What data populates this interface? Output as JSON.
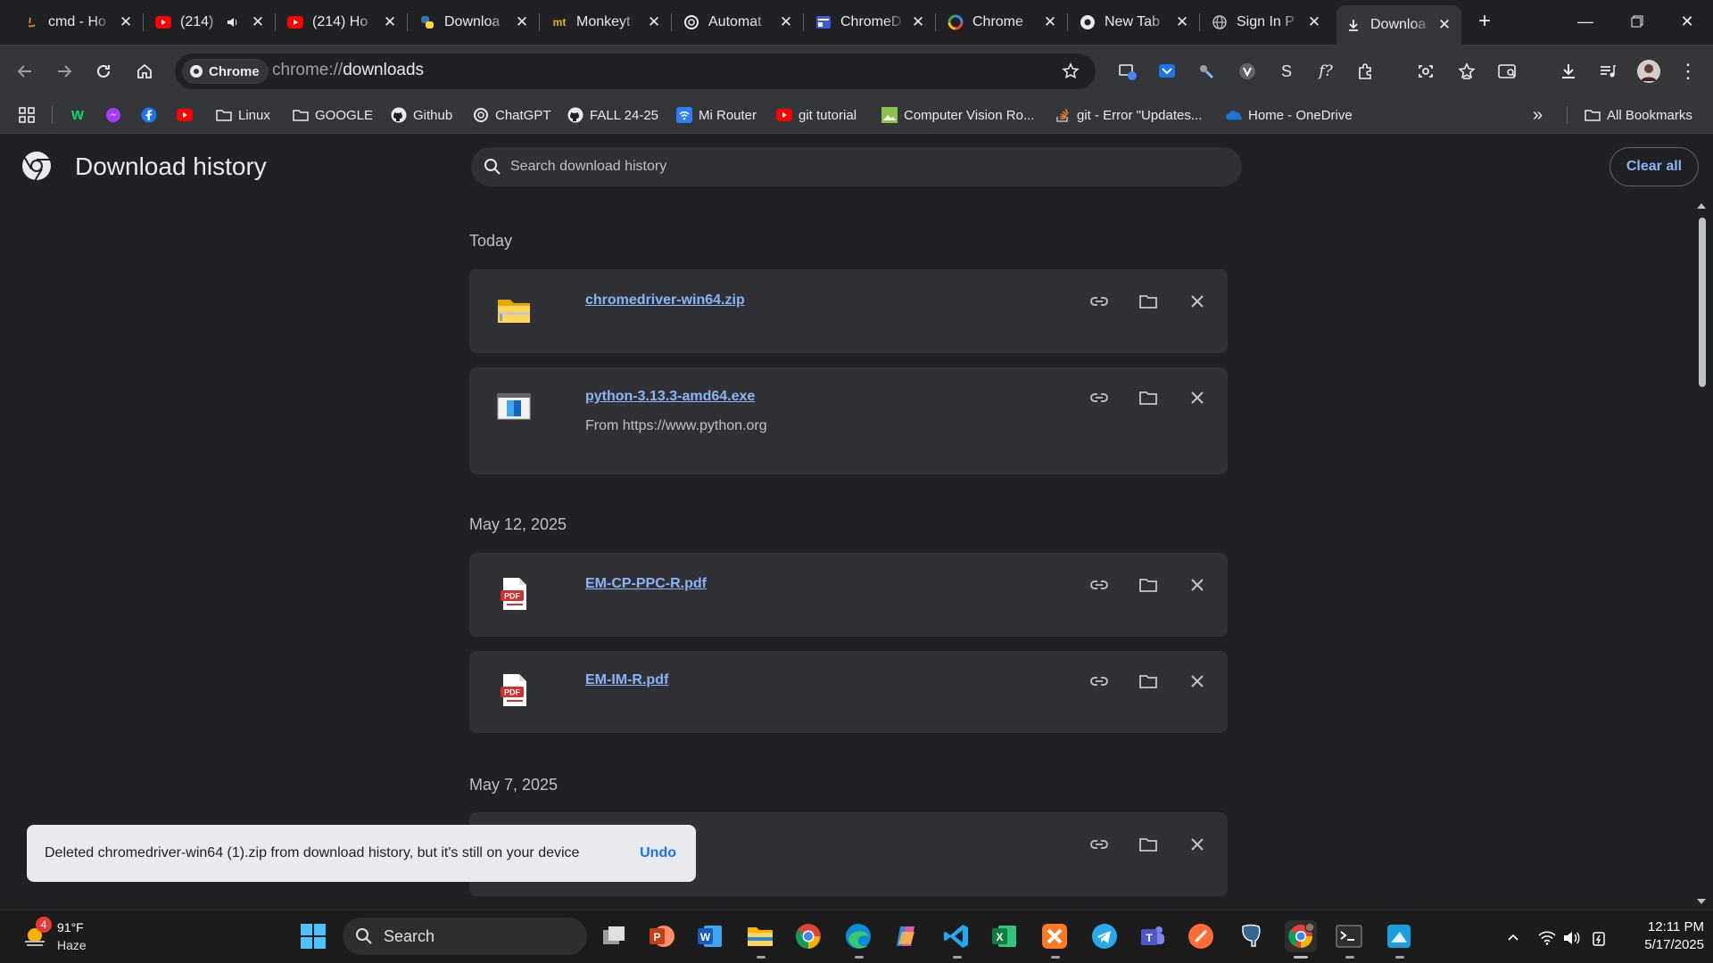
{
  "tabs": [
    {
      "title": "cmd - Ho",
      "icon": "java-icon"
    },
    {
      "title": "(214)",
      "icon": "youtube-icon"
    },
    {
      "title": "(214) Ho",
      "icon": "youtube-icon"
    },
    {
      "title": "Downloa",
      "icon": "python-icon"
    },
    {
      "title": "Monkeyt",
      "icon": "monkeytype-icon"
    },
    {
      "title": "Automat",
      "icon": "openai-icon"
    },
    {
      "title": "ChromeD",
      "icon": "chromedriver-icon"
    },
    {
      "title": "Chrome",
      "icon": "google-icon"
    },
    {
      "title": "New Tab",
      "icon": "chrome-icon"
    },
    {
      "title": "Sign In P",
      "icon": "globe-icon"
    },
    {
      "title": "Downloa",
      "icon": "download-icon"
    }
  ],
  "omnibox": {
    "chip_label": "Chrome",
    "url_scheme": "chrome://",
    "url_host": "downloads"
  },
  "bookmarks": [
    {
      "label": "",
      "icon": "webtoon-icon"
    },
    {
      "label": "",
      "icon": "messenger-icon"
    },
    {
      "label": "",
      "icon": "facebook-icon"
    },
    {
      "label": "",
      "icon": "youtube-icon"
    },
    {
      "label": "Linux",
      "icon": "folder-icon"
    },
    {
      "label": "GOOGLE",
      "icon": "folder-icon"
    },
    {
      "label": "Github",
      "icon": "github-icon"
    },
    {
      "label": "ChatGPT",
      "icon": "openai-icon"
    },
    {
      "label": "FALL 24-25",
      "icon": "github-icon"
    },
    {
      "label": "Mi Router",
      "icon": "wifi-icon"
    },
    {
      "label": "git tutorial",
      "icon": "youtube-icon"
    },
    {
      "label": "Computer Vision Ro...",
      "icon": "image-icon"
    },
    {
      "label": "git - Error \"Updates...",
      "icon": "stackoverflow-icon"
    },
    {
      "label": "Home - OneDrive",
      "icon": "onedrive-icon"
    }
  ],
  "all_bookmarks_label": "All Bookmarks",
  "page": {
    "title": "Download history",
    "search_placeholder": "Search download history",
    "clear_all": "Clear all"
  },
  "groups": [
    {
      "date": "Today",
      "items": [
        {
          "name": "chromedriver-win64.zip",
          "source": "",
          "icon": "zip-folder-icon"
        },
        {
          "name": "python-3.13.3-amd64.exe",
          "source": "From https://www.python.org",
          "icon": "installer-icon"
        }
      ]
    },
    {
      "date": "May 12, 2025",
      "items": [
        {
          "name": "EM-CP-PPC-R.pdf",
          "source": "",
          "icon": "pdf-icon"
        },
        {
          "name": "EM-IM-R.pdf",
          "source": "",
          "icon": "pdf-icon"
        }
      ]
    },
    {
      "date": "May 7, 2025",
      "items": []
    }
  ],
  "toast": {
    "message": "Deleted chromedriver-win64 (1).zip from download history, but it's still on your device",
    "undo": "Undo"
  },
  "taskbar": {
    "weather_temp": "91°F",
    "weather_desc": "Haze",
    "weather_badge": "4",
    "search_label": "Search",
    "time": "12:11 PM",
    "date": "5/17/2025"
  },
  "colors": {
    "link": "#8ab4f8",
    "background": "#202124",
    "card": "#303134",
    "toast_undo": "#1a73e8"
  }
}
